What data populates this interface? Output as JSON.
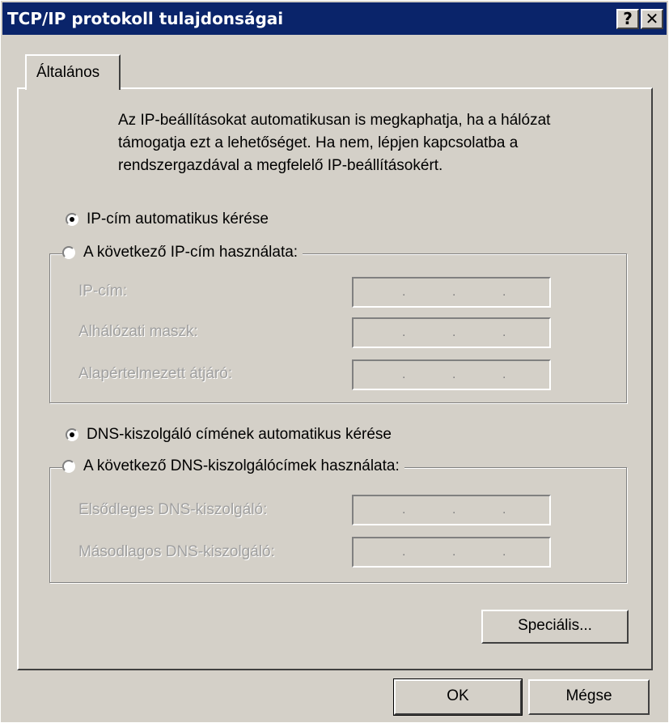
{
  "window": {
    "title": "TCP/IP protokoll tulajdonságai",
    "help_button": "?",
    "close_button": "✕"
  },
  "tabs": [
    {
      "label": "Általános"
    }
  ],
  "intro_text": "Az IP-beállításokat automatikusan is megkaphatja, ha a hálózat támogatja ezt a lehetőséget. Ha nem, lépjen kapcsolatba a rendszergazdával a megfelelő IP-beállításokért.",
  "ip": {
    "auto_label": "IP-cím automatikus kérése",
    "manual_label": "A következő IP-cím használata:",
    "selected": "auto",
    "fields": [
      {
        "label": "IP-cím:",
        "value": ". . ."
      },
      {
        "label": "Alhálózati maszk:",
        "value": ". . ."
      },
      {
        "label": "Alapértelmezett átjáró:",
        "value": ". . ."
      }
    ]
  },
  "dns": {
    "auto_label": "DNS-kiszolgáló címének automatikus kérése",
    "manual_label": "A következő DNS-kiszolgálócímek használata:",
    "selected": "auto",
    "fields": [
      {
        "label": "Elsődleges DNS-kiszolgáló:",
        "value": ". . ."
      },
      {
        "label": "Másodlagos DNS-kiszolgáló:",
        "value": ". . ."
      }
    ]
  },
  "buttons": {
    "advanced": "Speciális...",
    "ok": "OK",
    "cancel": "Mégse"
  },
  "colors": {
    "titlebar": "#0a246a",
    "face": "#d4d0c8",
    "disabled_text": "#a0a0a0"
  }
}
